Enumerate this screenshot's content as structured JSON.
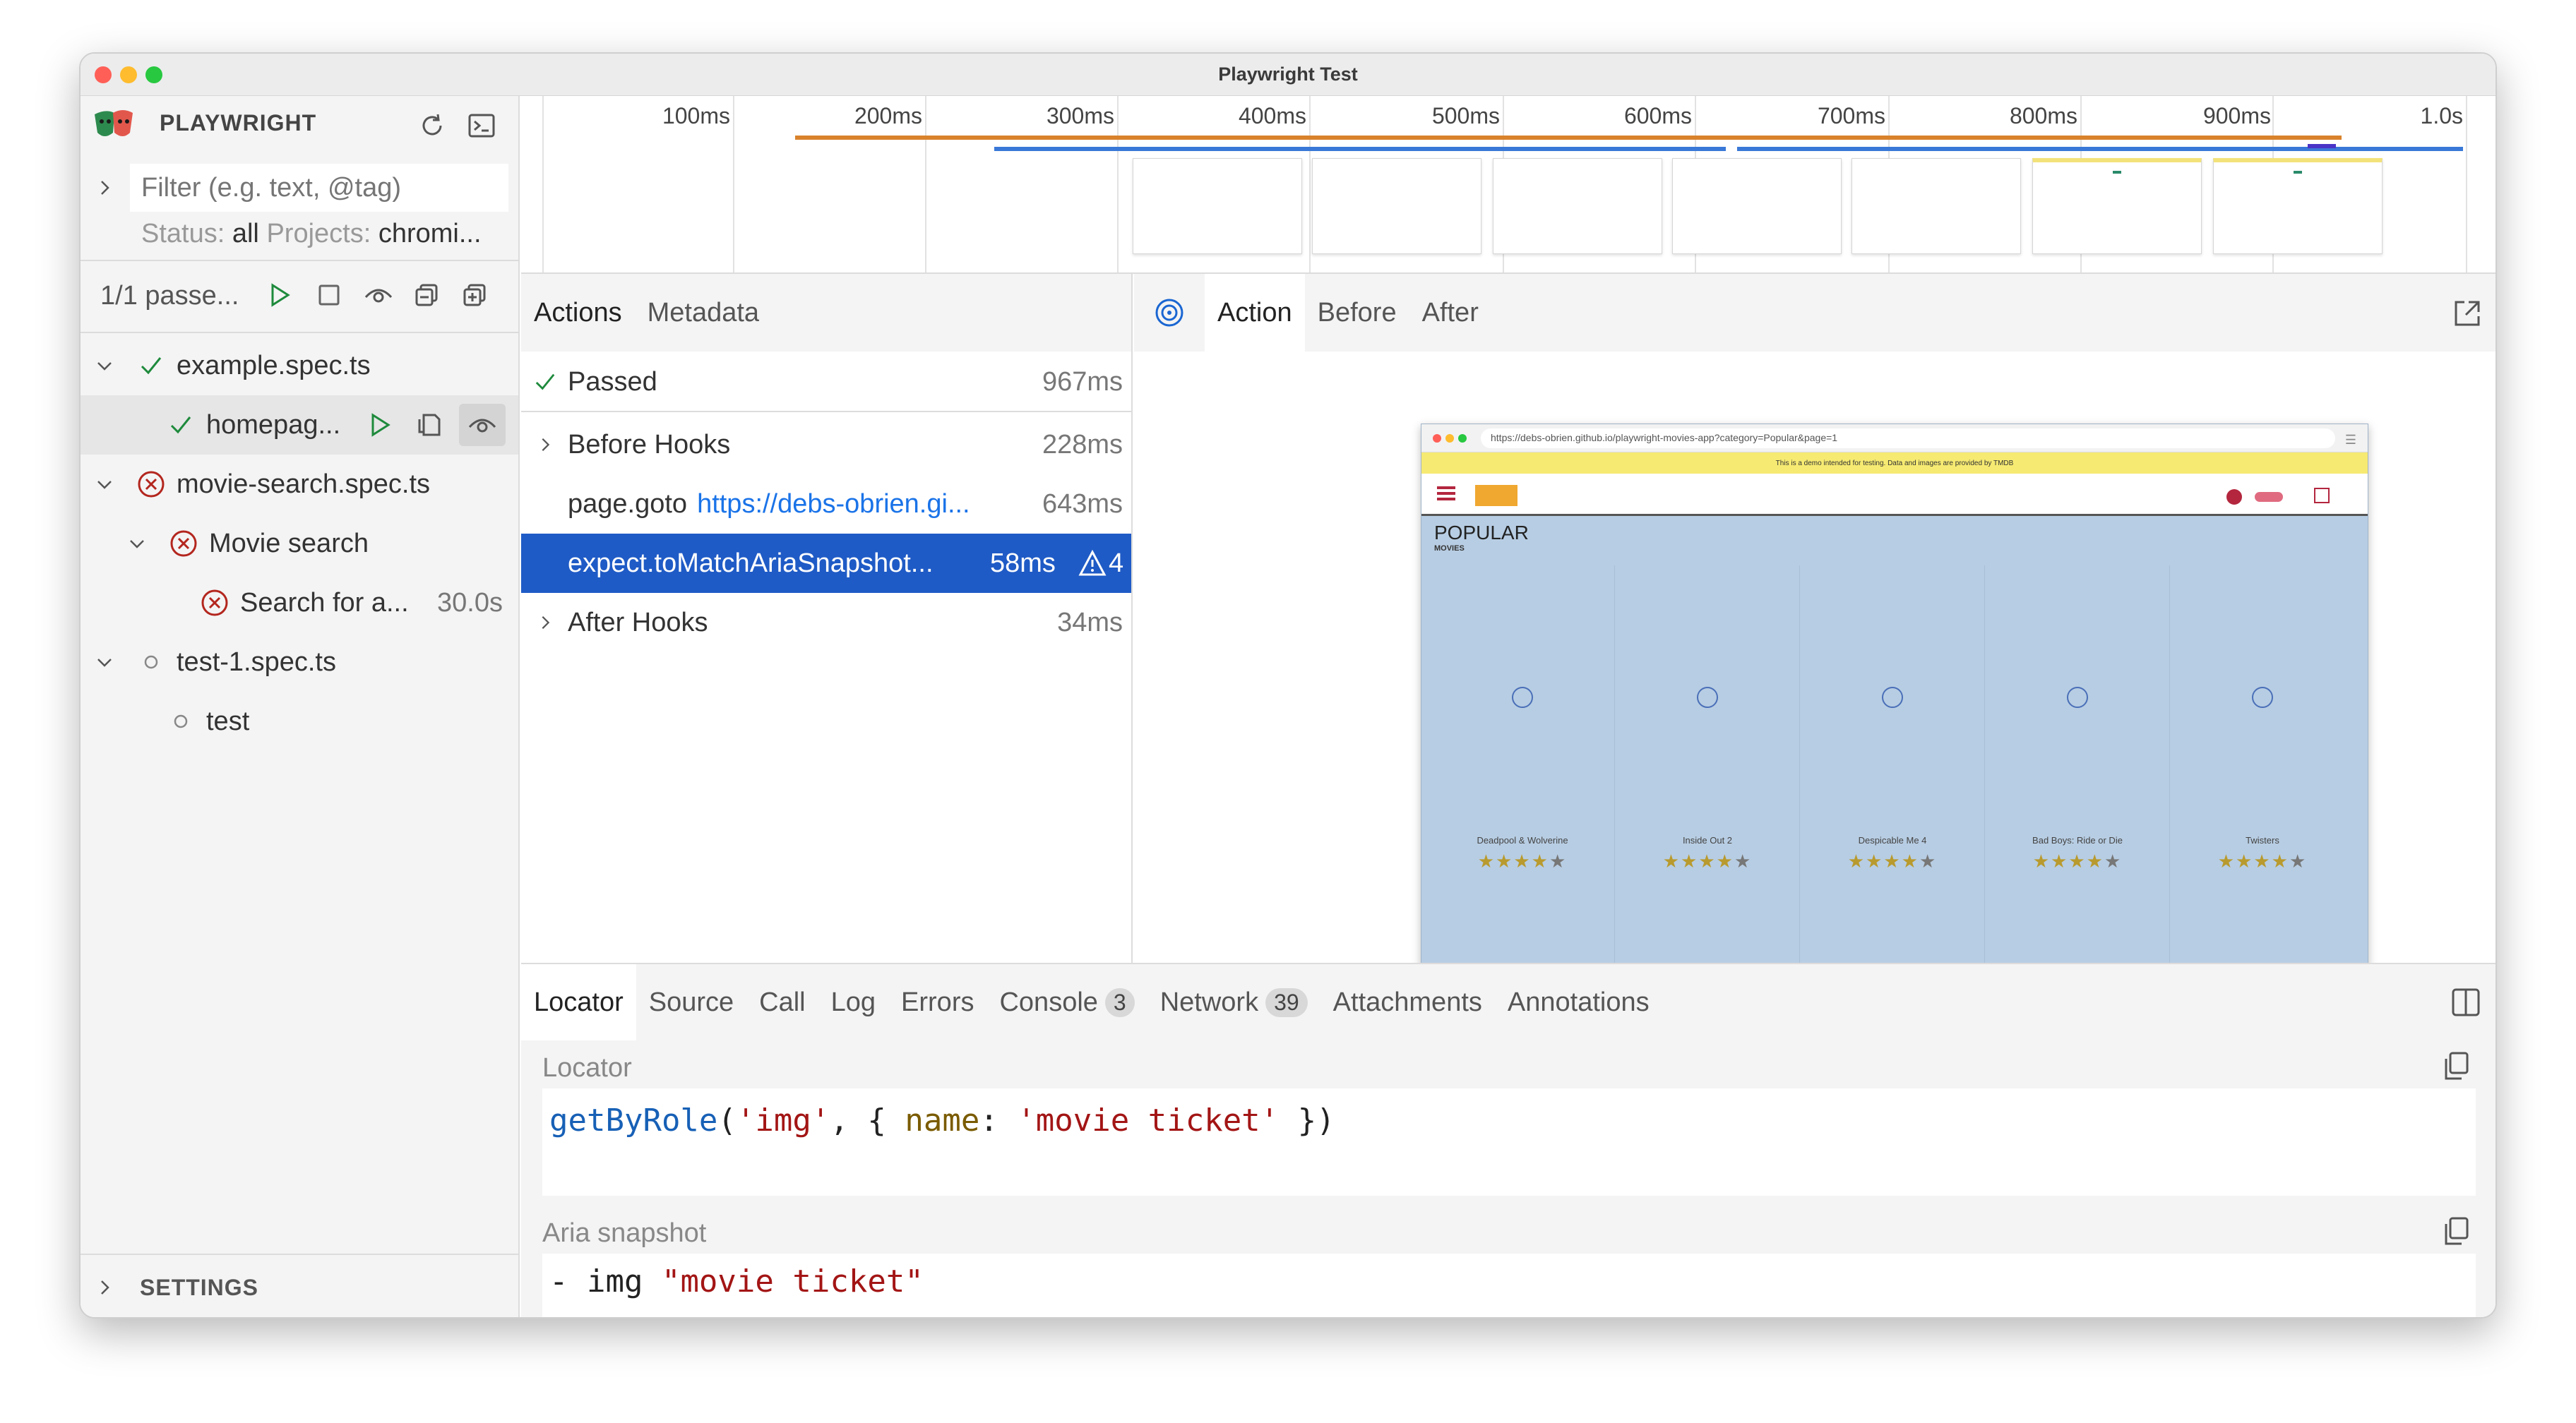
{
  "window": {
    "title": "Playwright Test"
  },
  "sidebar": {
    "brand": "PLAYWRIGHT",
    "filter_placeholder": "Filter (e.g. text, @tag)",
    "status_label": "Status:",
    "status_value": "all",
    "projects_label": "Projects:",
    "projects_value": "chromi...",
    "run_summary": "1/1 passe...",
    "tree": [
      {
        "label": "example.spec.ts",
        "status": "passed"
      },
      {
        "label": "homepag...",
        "status": "passed"
      },
      {
        "label": "movie-search.spec.ts",
        "status": "failed"
      },
      {
        "label": "Movie search",
        "status": "failed"
      },
      {
        "label": "Search for a...",
        "status": "failed",
        "duration": "30.0s"
      },
      {
        "label": "test-1.spec.ts",
        "status": "pending"
      },
      {
        "label": "test",
        "status": "pending"
      }
    ],
    "settings": "SETTINGS"
  },
  "timeline": {
    "ticks": [
      "100ms",
      "200ms",
      "300ms",
      "400ms",
      "500ms",
      "600ms",
      "700ms",
      "800ms",
      "900ms",
      "1.0s"
    ]
  },
  "actions_panel": {
    "tabs": [
      "Actions",
      "Metadata"
    ],
    "rows": [
      {
        "label": "Passed",
        "duration": "967ms"
      },
      {
        "label": "Before Hooks",
        "duration": "228ms"
      },
      {
        "label": "page.goto",
        "link": "https://debs-obrien.gi...",
        "duration": "643ms"
      },
      {
        "label": "expect.toMatchAriaSnapshot...",
        "duration": "58ms",
        "warnings": "4"
      },
      {
        "label": "After Hooks",
        "duration": "34ms"
      }
    ]
  },
  "detail_panel": {
    "tabs": [
      "Action",
      "Before",
      "After"
    ],
    "snapshot": {
      "url": "https://debs-obrien.github.io/playwright-movies-app?category=Popular&page=1",
      "banner": "This is a demo intended for testing. Data and images are provided by TMDB",
      "heading": "POPULAR",
      "subheading": "MOVIES",
      "movies": [
        "Deadpool & Wolverine",
        "Inside Out 2",
        "Despicable Me 4",
        "Bad Boys: Ride or Die",
        "Twisters"
      ]
    }
  },
  "bottom_panel": {
    "tabs": [
      "Locator",
      "Source",
      "Call",
      "Log",
      "Errors",
      "Console",
      "Network",
      "Attachments",
      "Annotations"
    ],
    "console_count": "3",
    "network_count": "39",
    "locator_title": "Locator",
    "locator_code": {
      "fn": "getByRole",
      "open": "(",
      "arg1": "'img'",
      "mid": ", { ",
      "key": "name",
      "colon": ": ",
      "arg2": "'movie ticket'",
      "close": " })"
    },
    "aria_title": "Aria snapshot",
    "aria_code": {
      "dash": "- img ",
      "name": "\"movie ticket\""
    }
  },
  "colors": {
    "accent": "#0d5bd3",
    "selected_row": "#1f5bc6",
    "timeline_orange": "#d9822b",
    "timeline_blue": "#3a78d8"
  }
}
